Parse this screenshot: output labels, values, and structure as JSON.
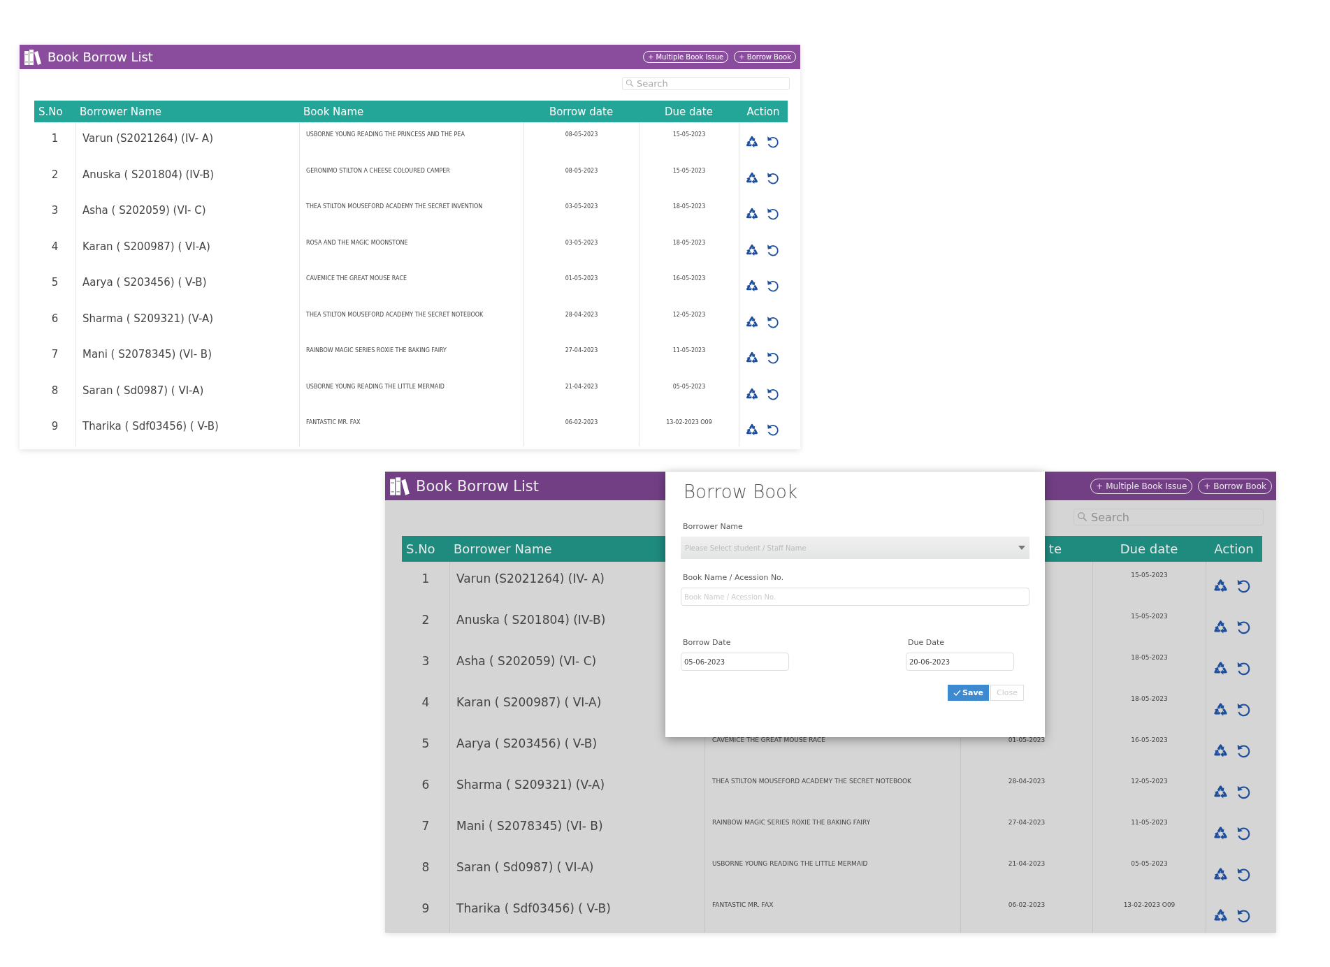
{
  "list_view": {
    "title": "Book Borrow List",
    "buttons": [
      "+ Multiple Book Issue",
      "+ Borrow Book"
    ],
    "search": {
      "placeholder": "Search"
    },
    "columns": [
      "S.No",
      "Borrower Name",
      "Book Name",
      "Borrow date",
      "Due date",
      "Action"
    ],
    "rows": [
      {
        "sno": "1",
        "borrower": "Varun (S2021264)  (IV- A)",
        "book": "USBORNE YOUNG READING THE PRINCESS AND THE PEA",
        "borrow_date": "08-05-2023",
        "due_date": "15-05-2023"
      },
      {
        "sno": "2",
        "borrower": "Anuska ( S201804)  (IV-B)",
        "book": "GERONIMO STILTON A CHEESE COLOURED CAMPER",
        "borrow_date": "08-05-2023",
        "due_date": "15-05-2023"
      },
      {
        "sno": "3",
        "borrower": "Asha ( S202059)  (VI- C)",
        "book": "THEA STILTON MOUSEFORD ACADEMY THE SECRET INVENTION",
        "borrow_date": "03-05-2023",
        "due_date": "18-05-2023"
      },
      {
        "sno": "4",
        "borrower": "Karan ( S200987) ( VI-A)",
        "book": "ROSA AND THE MAGIC MOONSTONE",
        "borrow_date": "03-05-2023",
        "due_date": "18-05-2023"
      },
      {
        "sno": "5",
        "borrower": "Aarya ( S203456)  ( V-B)",
        "book": "CAVEMICE THE GREAT MOUSE RACE",
        "borrow_date": "01-05-2023",
        "due_date": "16-05-2023"
      },
      {
        "sno": "6",
        "borrower": "Sharma ( S209321) (V-A)",
        "book": "THEA STILTON MOUSEFORD ACADEMY THE SECRET NOTEBOOK",
        "borrow_date": "28-04-2023",
        "due_date": "12-05-2023"
      },
      {
        "sno": "7",
        "borrower": "Mani ( S2078345) (VI- B)",
        "book": "RAINBOW MAGIC SERIES ROXIE THE BAKING FAIRY",
        "borrow_date": "27-04-2023",
        "due_date": "11-05-2023"
      },
      {
        "sno": "8",
        "borrower": "Saran ( Sd0987) ( VI-A)",
        "book": "USBORNE YOUNG READING THE LITTLE MERMAID",
        "borrow_date": "21-04-2023",
        "due_date": "05-05-2023"
      },
      {
        "sno": "9",
        "borrower": "Tharika ( Sdf03456)  ( V-B)",
        "book": "FANTASTIC MR. FAX",
        "borrow_date": "06-02-2023",
        "due_date": "13-02-2023 O09"
      }
    ]
  },
  "modal_view": {
    "title": "Book Borrow List",
    "buttons": [
      "+ Multiple Book Issue",
      "+ Borrow Book"
    ],
    "search": {
      "placeholder": "Search"
    },
    "columns": {
      "column_1": "S.No",
      "column_2": "Borrower Name",
      "column_4": "te",
      "column_5": "Due date",
      "column_6": "Action"
    },
    "rows": [
      {
        "sno": "1",
        "borrower": "Varun (S2021264)  (IV- A)",
        "due_date": "15-05-2023"
      },
      {
        "sno": "2",
        "borrower": "Anuska ( S201804)  (IV-B)",
        "due_date": "15-05-2023"
      },
      {
        "sno": "3",
        "borrower": "Asha ( S202059)  (VI- C)",
        "due_date": "18-05-2023"
      },
      {
        "sno": "4",
        "borrower": "Karan ( S200987) ( VI-A)",
        "due_date": "18-05-2023"
      },
      {
        "sno": "5",
        "borrower": "Aarya ( S203456)  ( V-B)",
        "book": "CAVEMICE THE GREAT MOUSE RACE",
        "borrow_date": "01-05-2023",
        "due_date": "16-05-2023"
      },
      {
        "sno": "6",
        "borrower": "Sharma ( S209321) (V-A)",
        "book": "THEA STILTON MOUSEFORD ACADEMY THE SECRET NOTEBOOK",
        "borrow_date": "28-04-2023",
        "due_date": "12-05-2023"
      },
      {
        "sno": "7",
        "borrower": "Mani ( S2078345) (VI- B)",
        "book": "RAINBOW MAGIC SERIES ROXIE THE BAKING FAIRY",
        "borrow_date": "27-04-2023",
        "due_date": "11-05-2023"
      },
      {
        "sno": "8",
        "borrower": "Saran ( Sd0987) ( VI-A)",
        "book": "USBORNE YOUNG READING THE LITTLE MERMAID",
        "borrow_date": "21-04-2023",
        "due_date": "05-05-2023"
      },
      {
        "sno": "9",
        "borrower": "Tharika ( Sdf03456)  ( V-B)",
        "book": "FANTASTIC MR. FAX",
        "borrow_date": "06-02-2023",
        "due_date": "13-02-2023 O09"
      }
    ],
    "modal": {
      "title": "Borrow Book",
      "fields": [
        {
          "kind": "select",
          "label": "Borrower Name",
          "placeholder": "Please Select student / Staff Name"
        },
        {
          "kind": "text",
          "label": "Book Name / Acession No.",
          "placeholder": "Book Name / Acession No."
        },
        {
          "kind": "date",
          "label": "Borrow Date",
          "value": "05-06-2023"
        },
        {
          "kind": "date",
          "label": "Due Date",
          "value": "20-06-2023"
        }
      ],
      "buttons": [
        {
          "kind": "primary",
          "label": "Save"
        },
        {
          "kind": "secondary",
          "label": "Close"
        }
      ]
    }
  }
}
